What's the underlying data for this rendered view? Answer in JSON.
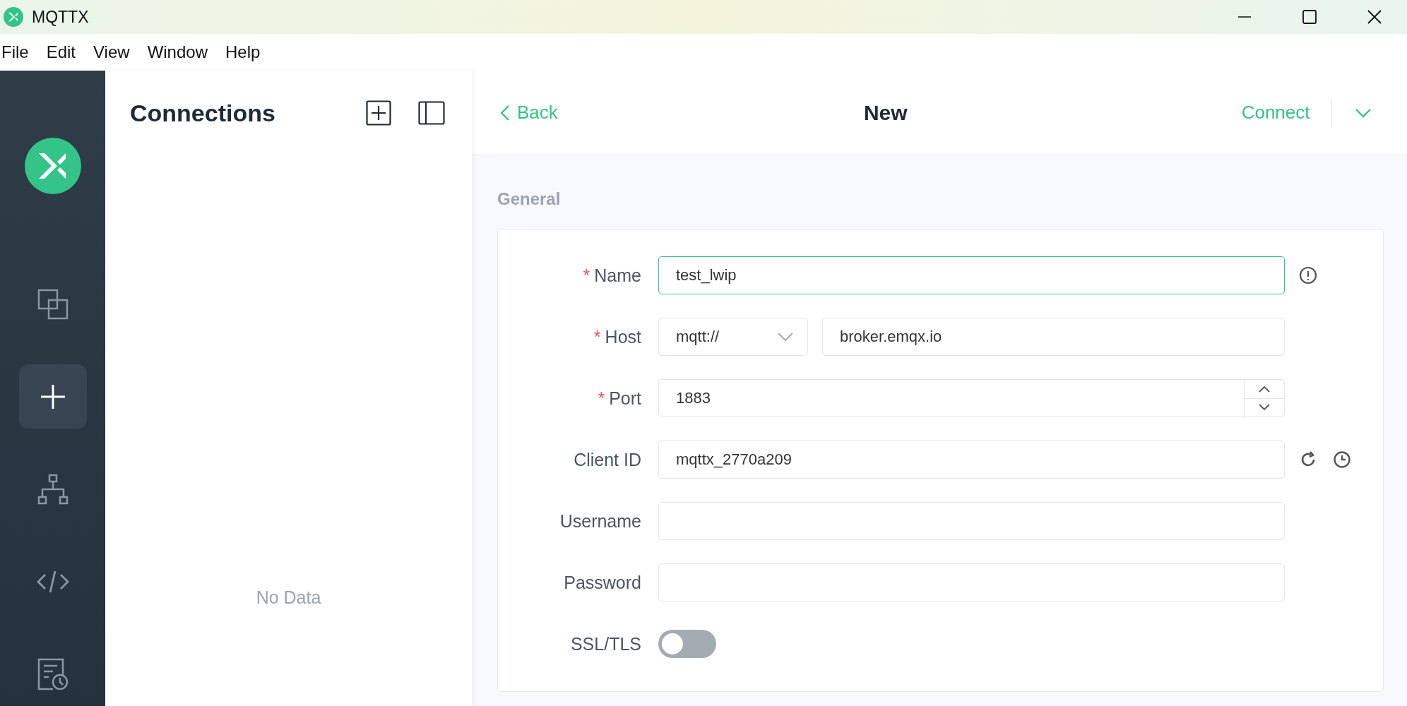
{
  "window": {
    "title": "MQTTX"
  },
  "menu": [
    "File",
    "Edit",
    "View",
    "Window",
    "Help"
  ],
  "nav": [
    {
      "selected": false
    },
    {
      "selected": false
    },
    {
      "selected": true
    },
    {
      "selected": false
    },
    {
      "selected": false
    },
    {
      "selected": false
    }
  ],
  "connections": {
    "title": "Connections",
    "empty_text": "No Data"
  },
  "editor": {
    "back": "Back",
    "title": "New",
    "connect": "Connect",
    "section": "General",
    "fields": [
      {
        "kind": "checked",
        "label": "Name",
        "required_mark": "*",
        "value": "test_lwip",
        "focused": true
      },
      {
        "kind": "host",
        "label": "Host",
        "required_mark": "*",
        "protocol": "mqtt://",
        "value": "broker.emqx.io",
        "focused": false
      },
      {
        "kind": "number",
        "label": "Port",
        "required_mark": "*",
        "value": "1883",
        "focused": false
      },
      {
        "kind": "generated",
        "label": "Client ID",
        "value": "mqttx_2770a209",
        "focused": false
      },
      {
        "kind": "text",
        "label": "Username",
        "focused": false
      },
      {
        "kind": "text",
        "label": "Password",
        "focused": false
      },
      {
        "kind": "toggle",
        "label": "SSL/TLS",
        "on": false
      }
    ]
  }
}
